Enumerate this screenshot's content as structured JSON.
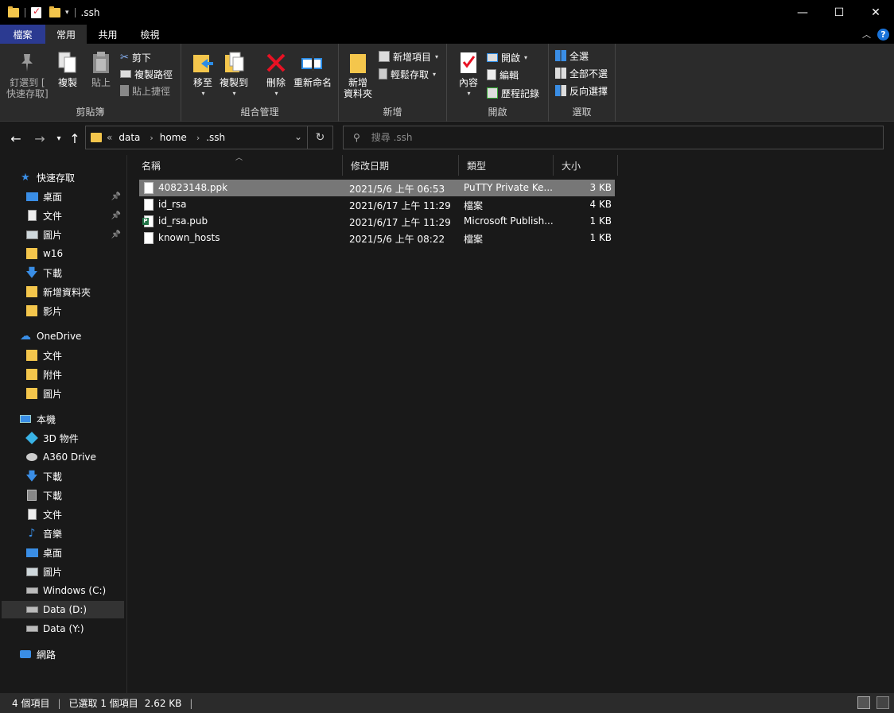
{
  "window": {
    "title": ".ssh",
    "minimize": "—",
    "maximize": "☐",
    "close": "✕"
  },
  "tabs": [
    "檔案",
    "常用",
    "共用",
    "檢視"
  ],
  "ribbon": {
    "clipboard": {
      "label": "剪貼簿",
      "pin": "釘選到 [\n快速存取]",
      "copy": "複製",
      "paste": "貼上",
      "cut": "剪下",
      "copy_path": "複製路徑",
      "paste_shortcut": "貼上捷徑"
    },
    "organize": {
      "label": "組合管理",
      "move_to": "移至",
      "copy_to": "複製到",
      "delete": "刪除",
      "rename": "重新命名"
    },
    "new": {
      "label": "新增",
      "new_folder": "新增\n資料夾",
      "new_item": "新增項目",
      "easy_access": "輕鬆存取"
    },
    "open": {
      "label": "開啟",
      "properties": "內容",
      "open": "開啟",
      "edit": "編輯",
      "history": "歷程記錄"
    },
    "select": {
      "label": "選取",
      "select_all": "全選",
      "select_none": "全部不選",
      "invert": "反向選擇"
    }
  },
  "address": {
    "overflow": "«",
    "crumbs": [
      "data",
      "home",
      ".ssh"
    ],
    "search_placeholder": "搜尋 .ssh"
  },
  "sidebar": {
    "quick_access": "快速存取",
    "quick_items": [
      {
        "label": "桌面",
        "icon": "desktop-icon",
        "pinned": true
      },
      {
        "label": "文件",
        "icon": "document-icon",
        "pinned": true
      },
      {
        "label": "圖片",
        "icon": "pictures-icon",
        "pinned": true
      },
      {
        "label": "w16",
        "icon": "folder-icon",
        "pinned": false
      },
      {
        "label": "下載",
        "icon": "download-icon",
        "pinned": false
      },
      {
        "label": "新增資料夾",
        "icon": "folder-icon",
        "pinned": false
      },
      {
        "label": "影片",
        "icon": "folder-icon",
        "pinned": false
      }
    ],
    "onedrive": "OneDrive",
    "onedrive_items": [
      "文件",
      "附件",
      "圖片"
    ],
    "this_pc": "本機",
    "pc_items": [
      {
        "label": "3D 物件",
        "icon": "3d-objects-icon"
      },
      {
        "label": "A360 Drive",
        "icon": "a360-drive-icon"
      },
      {
        "label": "下載",
        "icon": "download-icon"
      },
      {
        "label": "下載",
        "icon": "downloads-library-icon"
      },
      {
        "label": "文件",
        "icon": "document-icon"
      },
      {
        "label": "音樂",
        "icon": "music-icon"
      },
      {
        "label": "桌面",
        "icon": "desktop-icon"
      },
      {
        "label": "圖片",
        "icon": "pictures-icon"
      },
      {
        "label": "Windows (C:)",
        "icon": "drive-c-icon"
      },
      {
        "label": "Data (D:)",
        "icon": "drive-d-icon"
      },
      {
        "label": "Data (Y:)",
        "icon": "drive-y-icon"
      }
    ],
    "network": "網路"
  },
  "columns": [
    "名稱",
    "修改日期",
    "類型",
    "大小"
  ],
  "files": [
    {
      "name": "40823148.ppk",
      "modified": "2021/5/6 上午 06:53",
      "type": "PuTTY Private Ke...",
      "size": "3 KB",
      "selected": true,
      "icon": "file-icon"
    },
    {
      "name": "id_rsa",
      "modified": "2021/6/17 上午 11:29",
      "type": "檔案",
      "size": "4 KB",
      "selected": false,
      "icon": "file-icon"
    },
    {
      "name": "id_rsa.pub",
      "modified": "2021/6/17 上午 11:29",
      "type": "Microsoft Publish...",
      "size": "1 KB",
      "selected": false,
      "icon": "publisher-file-icon"
    },
    {
      "name": "known_hosts",
      "modified": "2021/5/6 上午 08:22",
      "type": "檔案",
      "size": "1 KB",
      "selected": false,
      "icon": "file-icon"
    }
  ],
  "status": {
    "count": "4 個項目",
    "selected": "已選取 1 個項目",
    "size": "2.62 KB"
  }
}
